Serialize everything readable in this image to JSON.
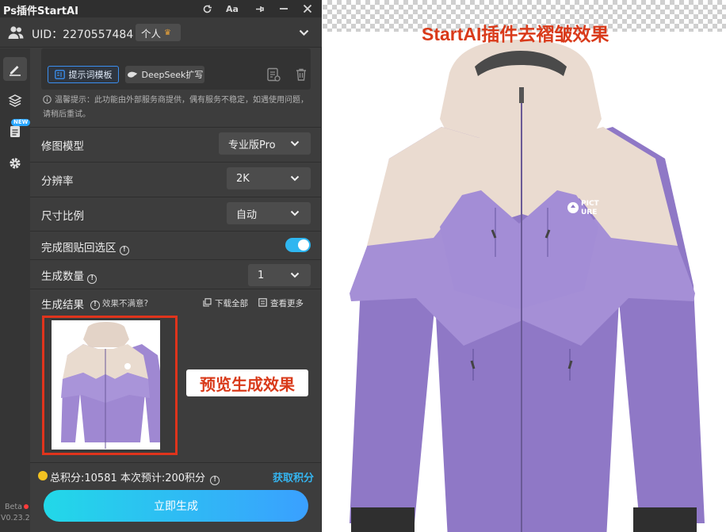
{
  "window": {
    "title": "Ps插件StartAI"
  },
  "user": {
    "uid_text": "UID：2270557484",
    "plan": "个人"
  },
  "prompt": {
    "template_label": "提示词模板",
    "deepseek_label": "DeepSeek扩写"
  },
  "tip": "温馨提示：此功能由外部服务商提供，偶有服务不稳定，如遇使用问题，请稍后重试。",
  "settings": {
    "model": {
      "label": "修图模型",
      "value": "专业版Pro"
    },
    "resolution": {
      "label": "分辨率",
      "value": "2K"
    },
    "ratio": {
      "label": "尺寸比例",
      "value": "自动"
    },
    "paste_back": {
      "label": "完成图贴回选区",
      "enabled": true
    },
    "count": {
      "label": "生成数量",
      "value": "1"
    }
  },
  "results": {
    "label": "生成结果",
    "unsatisfied": "效果不满意?",
    "download_all": "下载全部",
    "view_more": "查看更多"
  },
  "preview_annotation": "预览生成效果",
  "points": {
    "summary": "总积分:10581  本次预计:200积分",
    "get_link": "获取积分"
  },
  "generate_label": "立即生成",
  "sidebar": {
    "new_badge": "NEW",
    "beta": "Beta",
    "version": "V0.23.2"
  },
  "canvas": {
    "title": "StartAI插件去褶皱效果",
    "brand_line1": "PICT",
    "brand_line2": "URE"
  },
  "colors": {
    "accent": "#3aa0ff",
    "annotation_red": "#d93a1a",
    "jacket_beige": "#eadbd0",
    "jacket_lilac": "#a58fd6",
    "jacket_purple": "#8f78c6"
  }
}
